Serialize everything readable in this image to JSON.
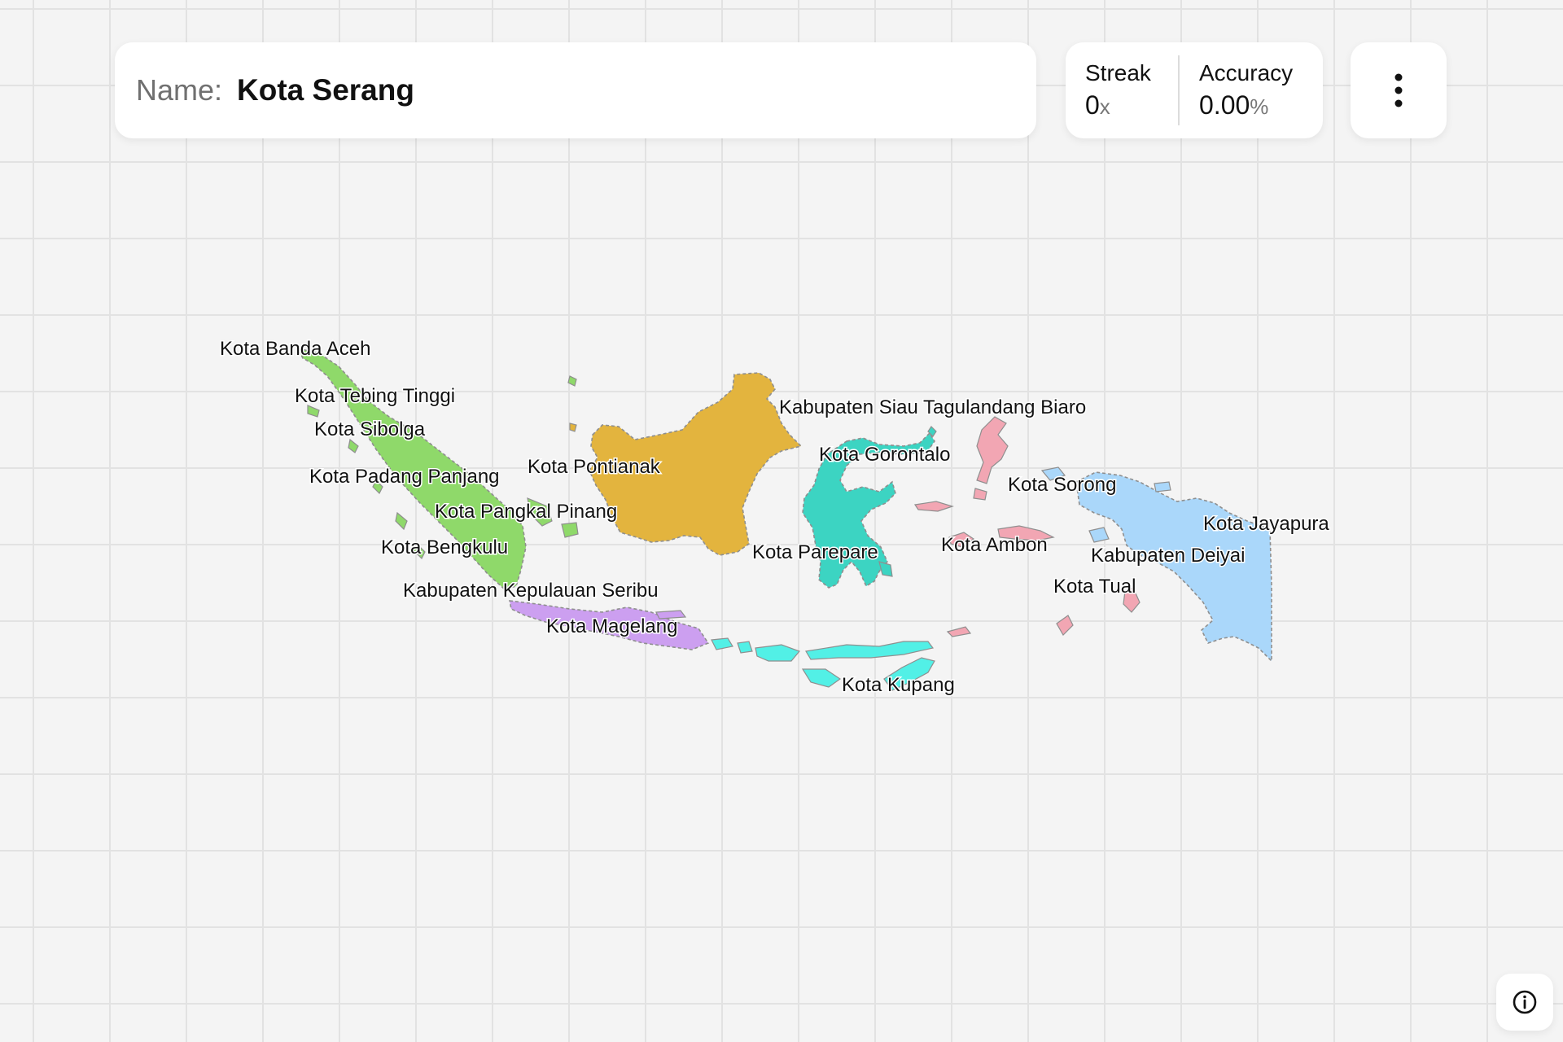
{
  "header": {
    "name_label": "Name:",
    "name_value": "Kota Serang"
  },
  "stats": {
    "streak_label": "Streak",
    "streak_value": "0",
    "streak_unit": "x",
    "accuracy_label": "Accuracy",
    "accuracy_value": "0.00",
    "accuracy_unit": "%"
  },
  "menu": {
    "icon": "more-vertical-icon"
  },
  "info": {
    "icon": "info-icon"
  },
  "map": {
    "regions": [
      {
        "name": "Sumatra",
        "color": "#8fd96a"
      },
      {
        "name": "Java",
        "color": "#cc9ff0"
      },
      {
        "name": "Kalimantan",
        "color": "#e3b43e"
      },
      {
        "name": "Sulawesi",
        "color": "#3cd4c2"
      },
      {
        "name": "Nusa Tenggara",
        "color": "#52f0e6"
      },
      {
        "name": "Maluku",
        "color": "#f2a6b3"
      },
      {
        "name": "Papua",
        "color": "#aad7fa"
      }
    ],
    "labels": [
      "Kota Banda Aceh",
      "Kota Tebing Tinggi",
      "Kota Sibolga",
      "Kota Padang Panjang",
      "Kota Pangkal Pinang",
      "Kota Bengkulu",
      "Kabupaten Kepulauan Seribu",
      "Kota Magelang",
      "Kota Pontianak",
      "Kabupaten Siau Tagulandang Biaro",
      "Kota Gorontalo",
      "Kota Parepare",
      "Kota Ambon",
      "Kota Sorong",
      "Kota Jayapura",
      "Kabupaten Deiyai",
      "Kota Tual",
      "Kota Kupang"
    ]
  }
}
